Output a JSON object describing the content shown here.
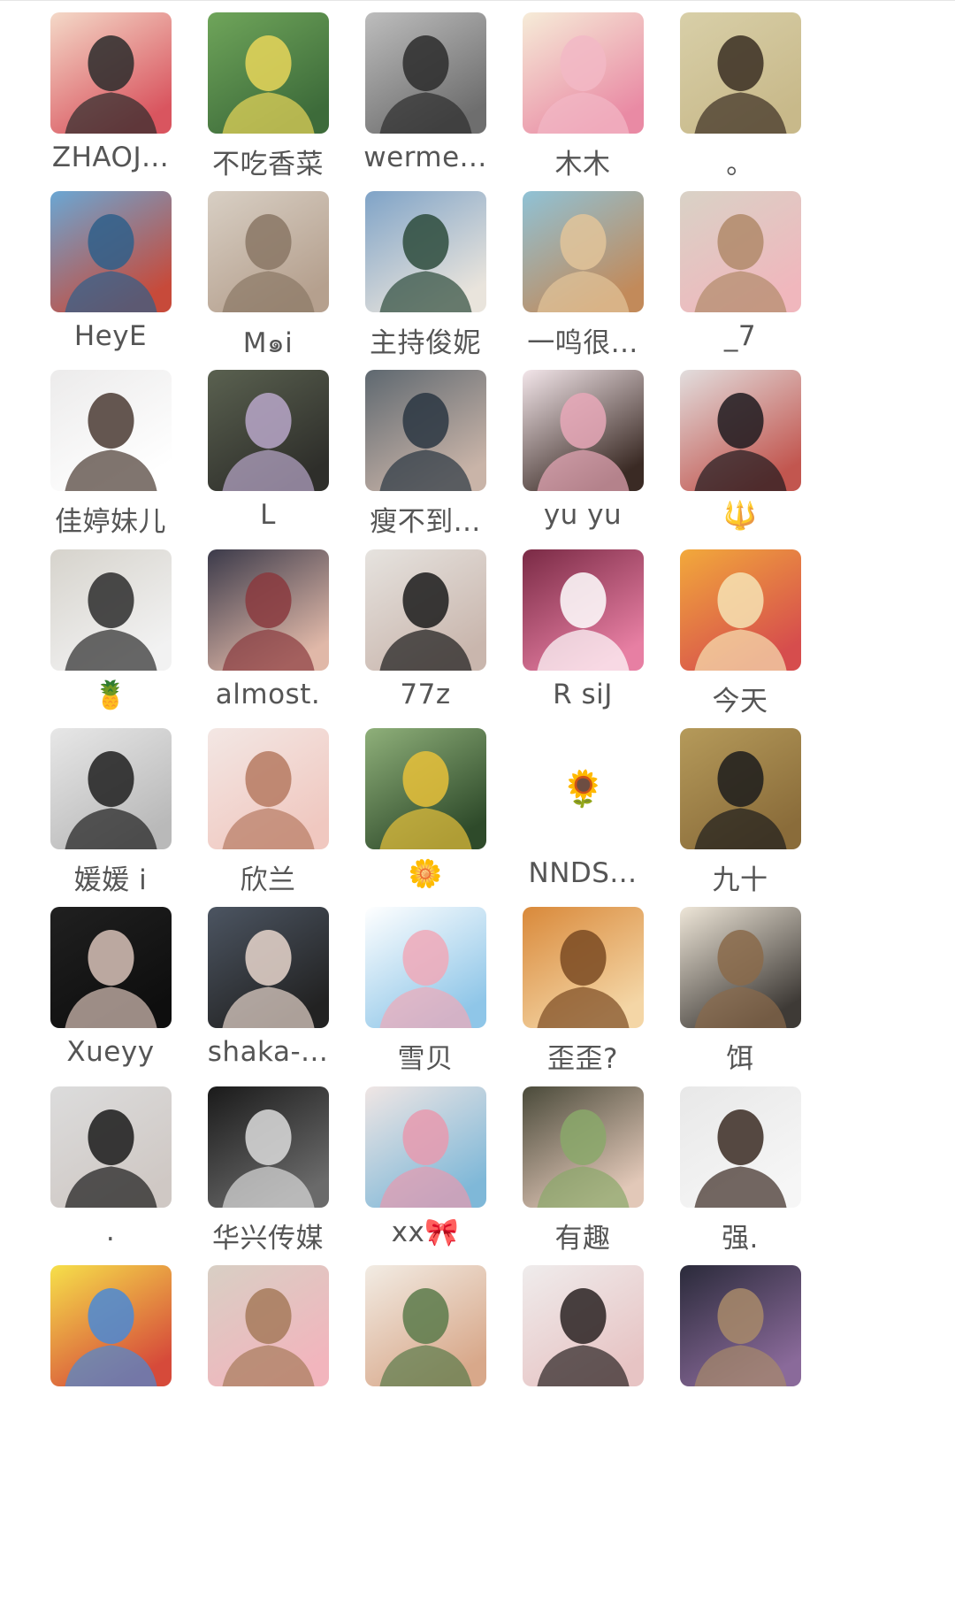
{
  "members": [
    {
      "name": "ZHAOJ...",
      "avatar": "cartoon-girl-frog-hat",
      "colors": [
        "#f4d9c8",
        "#2b2b2b",
        "#d9555f"
      ]
    },
    {
      "name": "不吃香菜",
      "avatar": "woman-yellow-dress-garden",
      "colors": [
        "#6fa55a",
        "#e8d65a",
        "#3d6b3a"
      ]
    },
    {
      "name": "werme...",
      "avatar": "woman-dark-portrait",
      "colors": [
        "#bdbdbd",
        "#2c2c2c",
        "#6e6e6e"
      ]
    },
    {
      "name": "木木",
      "avatar": "bear-lotus-sticker",
      "colors": [
        "#f6ecd8",
        "#f2b8c6",
        "#e98aa4"
      ]
    },
    {
      "name": "。",
      "avatar": "woman-long-hair-yellow",
      "colors": [
        "#d8cfa8",
        "#3a2e22",
        "#c8b98a"
      ]
    },
    {
      "name": "HeyE",
      "avatar": "woman-beach-back",
      "colors": [
        "#6aa7d4",
        "#2f5f8a",
        "#c74a3a"
      ]
    },
    {
      "name": "M๑i",
      "avatar": "woman-hair-closeup",
      "colors": [
        "#d8cfc4",
        "#8a7765",
        "#b5a08e"
      ]
    },
    {
      "name": "主持俊妮",
      "avatar": "woman-seaside-white-dress",
      "colors": [
        "#7fa3c7",
        "#2d4b3c",
        "#e9e4dc"
      ]
    },
    {
      "name": "一鸣很...",
      "avatar": "woman-blonde-seaside",
      "colors": [
        "#8fc2d6",
        "#e2c49a",
        "#c28a5a"
      ]
    },
    {
      "name": "_7",
      "avatar": "girl-pink-top",
      "colors": [
        "#d9d2c6",
        "#b08a6a",
        "#f0b7bd"
      ]
    },
    {
      "name": "佳婷妹儿",
      "avatar": "woman-white-hoodie",
      "colors": [
        "#ecebeb",
        "#4a3a32",
        "#ffffff"
      ]
    },
    {
      "name": "L",
      "avatar": "woman-lavender-dress",
      "colors": [
        "#5a6150",
        "#b8a7c9",
        "#2e2e2a"
      ]
    },
    {
      "name": "瘦不到...",
      "avatar": "woman-denim-jacket",
      "colors": [
        "#5e6870",
        "#2a3642",
        "#c9b4a8"
      ]
    },
    {
      "name": "yu yu",
      "avatar": "child-bunny-hat",
      "colors": [
        "#f3e6ea",
        "#e8a8b8",
        "#3a2a24"
      ]
    },
    {
      "name": "🔱",
      "avatar": "woman-short-black-hair",
      "colors": [
        "#e2dede",
        "#1e1a1e",
        "#c2564f"
      ]
    },
    {
      "name": "🍍",
      "avatar": "two-dogs-running",
      "colors": [
        "#d6d3cc",
        "#2b2b2b",
        "#f2f2f2"
      ]
    },
    {
      "name": "almost.",
      "avatar": "anime-woman-dark-hair",
      "colors": [
        "#3b3a4a",
        "#8a3a3e",
        "#e0b8a8"
      ]
    },
    {
      "name": "77z",
      "avatar": "woman-face-closeup",
      "colors": [
        "#e6e3df",
        "#1b1b1b",
        "#c9b6ad"
      ]
    },
    {
      "name": "R siJ",
      "avatar": "white-cat-cartoon",
      "colors": [
        "#7a2a45",
        "#ffffff",
        "#e77fa3"
      ]
    },
    {
      "name": "今天",
      "avatar": "chibi-maruko-blanket",
      "colors": [
        "#f2a93b",
        "#f6e3b4",
        "#d64d4d"
      ]
    },
    {
      "name": "媛媛 i",
      "avatar": "woman-dark-hair-bw",
      "colors": [
        "#e7e7e7",
        "#1e1e1e",
        "#b9b9b9"
      ]
    },
    {
      "name": "欣兰",
      "avatar": "woman-light-hair-pose",
      "colors": [
        "#f3e7e4",
        "#b67a62",
        "#f0c8c0"
      ]
    },
    {
      "name": "🌼",
      "avatar": "woman-sunflower-field",
      "colors": [
        "#8fb07a",
        "#e7c13a",
        "#2e4a2a"
      ]
    },
    {
      "name": "NNDS...",
      "avatar": "sunflower-emoji",
      "colors": [
        "#ffffff",
        "#e6b12a",
        "#5aa04a"
      ]
    },
    {
      "name": "九十",
      "avatar": "woman-black-coat-field",
      "colors": [
        "#b59a5a",
        "#1c1c1c",
        "#8a6c3a"
      ]
    },
    {
      "name": "Xueyy",
      "avatar": "woman-black-top-dark",
      "colors": [
        "#202020",
        "#d8c2b8",
        "#0e0e0e"
      ]
    },
    {
      "name": "shaka-...",
      "avatar": "woman-car-selfie",
      "colors": [
        "#4c5562",
        "#e7d6cc",
        "#222222"
      ]
    },
    {
      "name": "雪贝",
      "avatar": "illustration-balloon-girl",
      "colors": [
        "#ffffff",
        "#f0a9b8",
        "#8fc6e8"
      ]
    },
    {
      "name": "歪歪?",
      "avatar": "puss-in-boots-cat",
      "colors": [
        "#d9893a",
        "#7a4a22",
        "#f4d6a6"
      ]
    },
    {
      "name": "饵",
      "avatar": "small-dog-pillow",
      "colors": [
        "#eee6d8",
        "#8a6a4a",
        "#3e3a36"
      ]
    },
    {
      "name": ".",
      "avatar": "man-lying-black-hoodie",
      "colors": [
        "#dcdcdc",
        "#1a1a1a",
        "#cfc8c4"
      ]
    },
    {
      "name": "华兴传媒",
      "avatar": "stage-triangle-bw",
      "colors": [
        "#1a1a1a",
        "#dcdcdc",
        "#6a6a6a"
      ]
    },
    {
      "name": "xx🎀",
      "avatar": "woman-gifts-flowers",
      "colors": [
        "#f0e6e4",
        "#e79aaf",
        "#7fb8d8"
      ]
    },
    {
      "name": "有趣",
      "avatar": "woman-green-jacket-car",
      "colors": [
        "#4a4a3a",
        "#8aa86a",
        "#e2c8b8"
      ]
    },
    {
      "name": "强.",
      "avatar": "dog-bread-hat",
      "colors": [
        "#e8e8e8",
        "#3a2a22",
        "#f6f6f6"
      ]
    },
    {
      "name": "",
      "avatar": "spongebob",
      "colors": [
        "#f6e04a",
        "#4a8ad6",
        "#d64a3a"
      ]
    },
    {
      "name": "",
      "avatar": "girl-pink-top-2",
      "colors": [
        "#d8cfc4",
        "#a67a5a",
        "#f2b5bd"
      ]
    },
    {
      "name": "",
      "avatar": "illustration-woman-green",
      "colors": [
        "#f2ece4",
        "#5a7a4a",
        "#d8a88a"
      ]
    },
    {
      "name": "",
      "avatar": "woman-dark-hair-white",
      "colors": [
        "#efecec",
        "#2a2222",
        "#e7c4c4"
      ]
    },
    {
      "name": "",
      "avatar": "woman-arched-window",
      "colors": [
        "#2a2a3a",
        "#a88a6a",
        "#8a6a9a"
      ]
    }
  ]
}
